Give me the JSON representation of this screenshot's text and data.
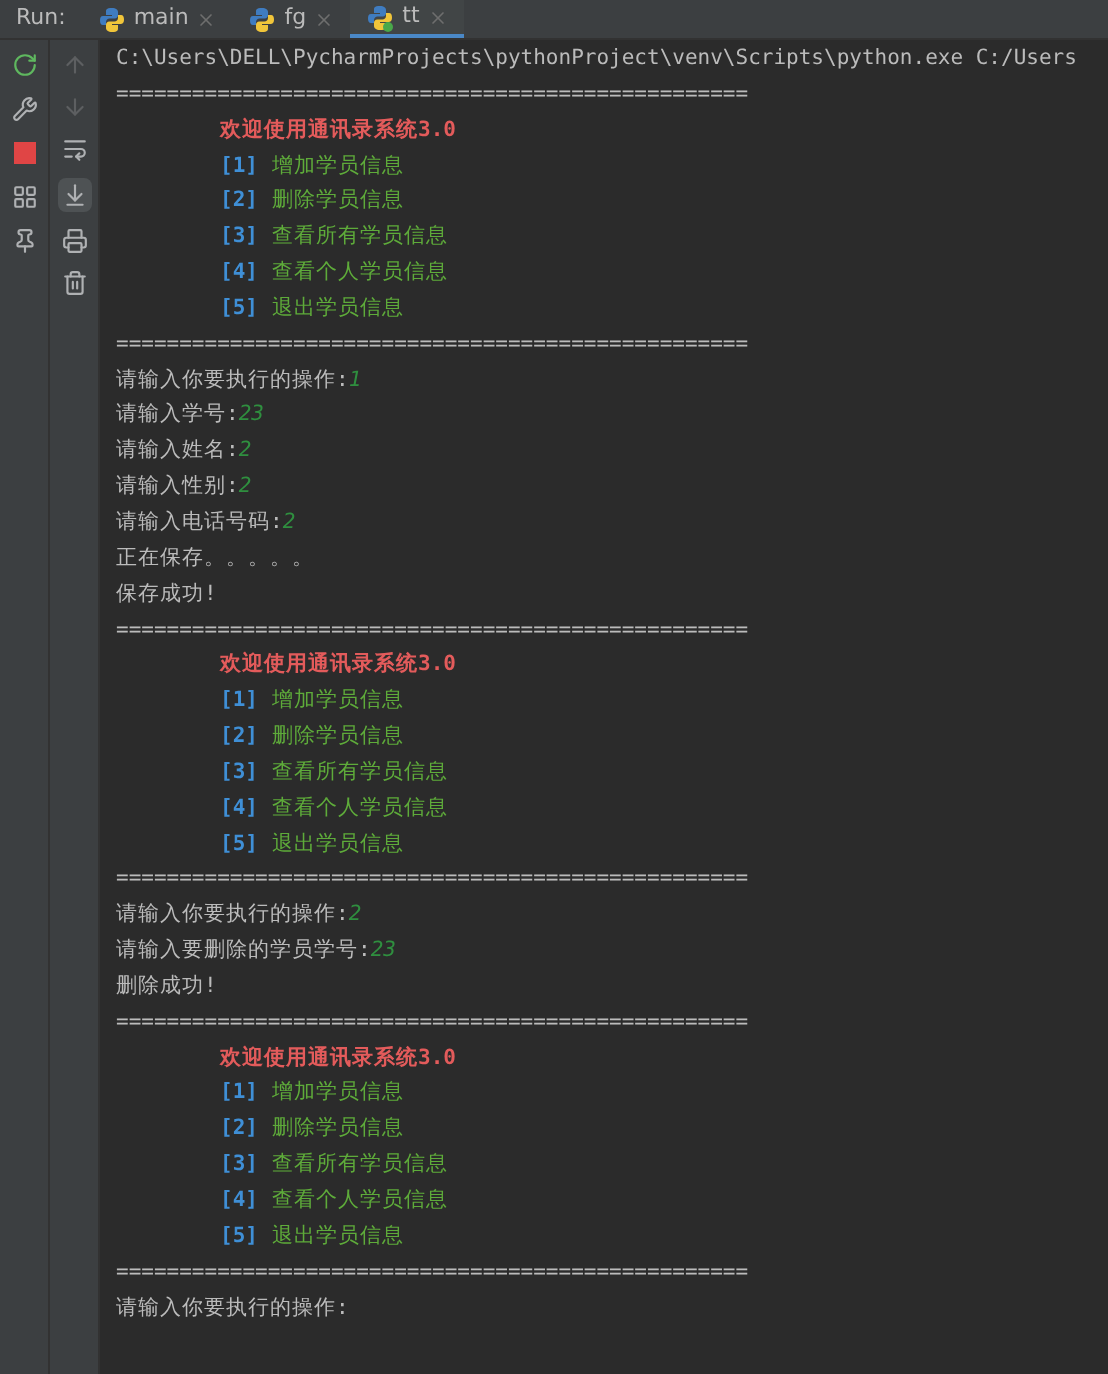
{
  "run_bar": {
    "label": "Run:",
    "tabs": [
      {
        "label": "main",
        "selected": false,
        "running": false
      },
      {
        "label": "fg",
        "selected": false,
        "running": false
      },
      {
        "label": "tt",
        "selected": true,
        "running": true
      }
    ]
  },
  "console": {
    "lines": [
      {
        "kind": "command",
        "text": "C:\\Users\\DELL\\PycharmProjects\\pythonProject\\venv\\Scripts\\python.exe C:/Users"
      },
      {
        "kind": "separator",
        "text": "=================================================="
      },
      {
        "kind": "title",
        "text": "欢迎使用通讯录系统3.0"
      },
      {
        "kind": "menu_item",
        "number": "[1]",
        "label": "增加学员信息"
      },
      {
        "kind": "menu_item",
        "number": "[2]",
        "label": "删除学员信息"
      },
      {
        "kind": "menu_item",
        "number": "[3]",
        "label": "查看所有学员信息"
      },
      {
        "kind": "menu_item",
        "number": "[4]",
        "label": "查看个人学员信息"
      },
      {
        "kind": "menu_item",
        "number": "[5]",
        "label": "退出学员信息"
      },
      {
        "kind": "separator",
        "text": "=================================================="
      },
      {
        "kind": "prompt",
        "text": "请输入你要执行的操作:",
        "input": "1"
      },
      {
        "kind": "prompt",
        "text": "请输入学号:",
        "input": "23"
      },
      {
        "kind": "prompt",
        "text": "请输入姓名:",
        "input": "2"
      },
      {
        "kind": "prompt",
        "text": "请输入性别:",
        "input": "2"
      },
      {
        "kind": "prompt",
        "text": "请输入电话号码:",
        "input": "2"
      },
      {
        "kind": "text",
        "text": "正在保存。。。。。"
      },
      {
        "kind": "text",
        "text": "保存成功!"
      },
      {
        "kind": "separator",
        "text": "=================================================="
      },
      {
        "kind": "title",
        "text": "欢迎使用通讯录系统3.0"
      },
      {
        "kind": "menu_item",
        "number": "[1]",
        "label": "增加学员信息"
      },
      {
        "kind": "menu_item",
        "number": "[2]",
        "label": "删除学员信息"
      },
      {
        "kind": "menu_item",
        "number": "[3]",
        "label": "查看所有学员信息"
      },
      {
        "kind": "menu_item",
        "number": "[4]",
        "label": "查看个人学员信息"
      },
      {
        "kind": "menu_item",
        "number": "[5]",
        "label": "退出学员信息"
      },
      {
        "kind": "separator",
        "text": "=================================================="
      },
      {
        "kind": "prompt",
        "text": "请输入你要执行的操作:",
        "input": "2"
      },
      {
        "kind": "prompt",
        "text": "请输入要删除的学员学号:",
        "input": "23"
      },
      {
        "kind": "text",
        "text": "删除成功!"
      },
      {
        "kind": "separator",
        "text": "=================================================="
      },
      {
        "kind": "title",
        "text": "欢迎使用通讯录系统3.0"
      },
      {
        "kind": "menu_item",
        "number": "[1]",
        "label": "增加学员信息"
      },
      {
        "kind": "menu_item",
        "number": "[2]",
        "label": "删除学员信息"
      },
      {
        "kind": "menu_item",
        "number": "[3]",
        "label": "查看所有学员信息"
      },
      {
        "kind": "menu_item",
        "number": "[4]",
        "label": "查看个人学员信息"
      },
      {
        "kind": "menu_item",
        "number": "[5]",
        "label": "退出学员信息"
      },
      {
        "kind": "separator",
        "text": "=================================================="
      },
      {
        "kind": "prompt",
        "text": "请输入你要执行的操作:"
      }
    ]
  }
}
